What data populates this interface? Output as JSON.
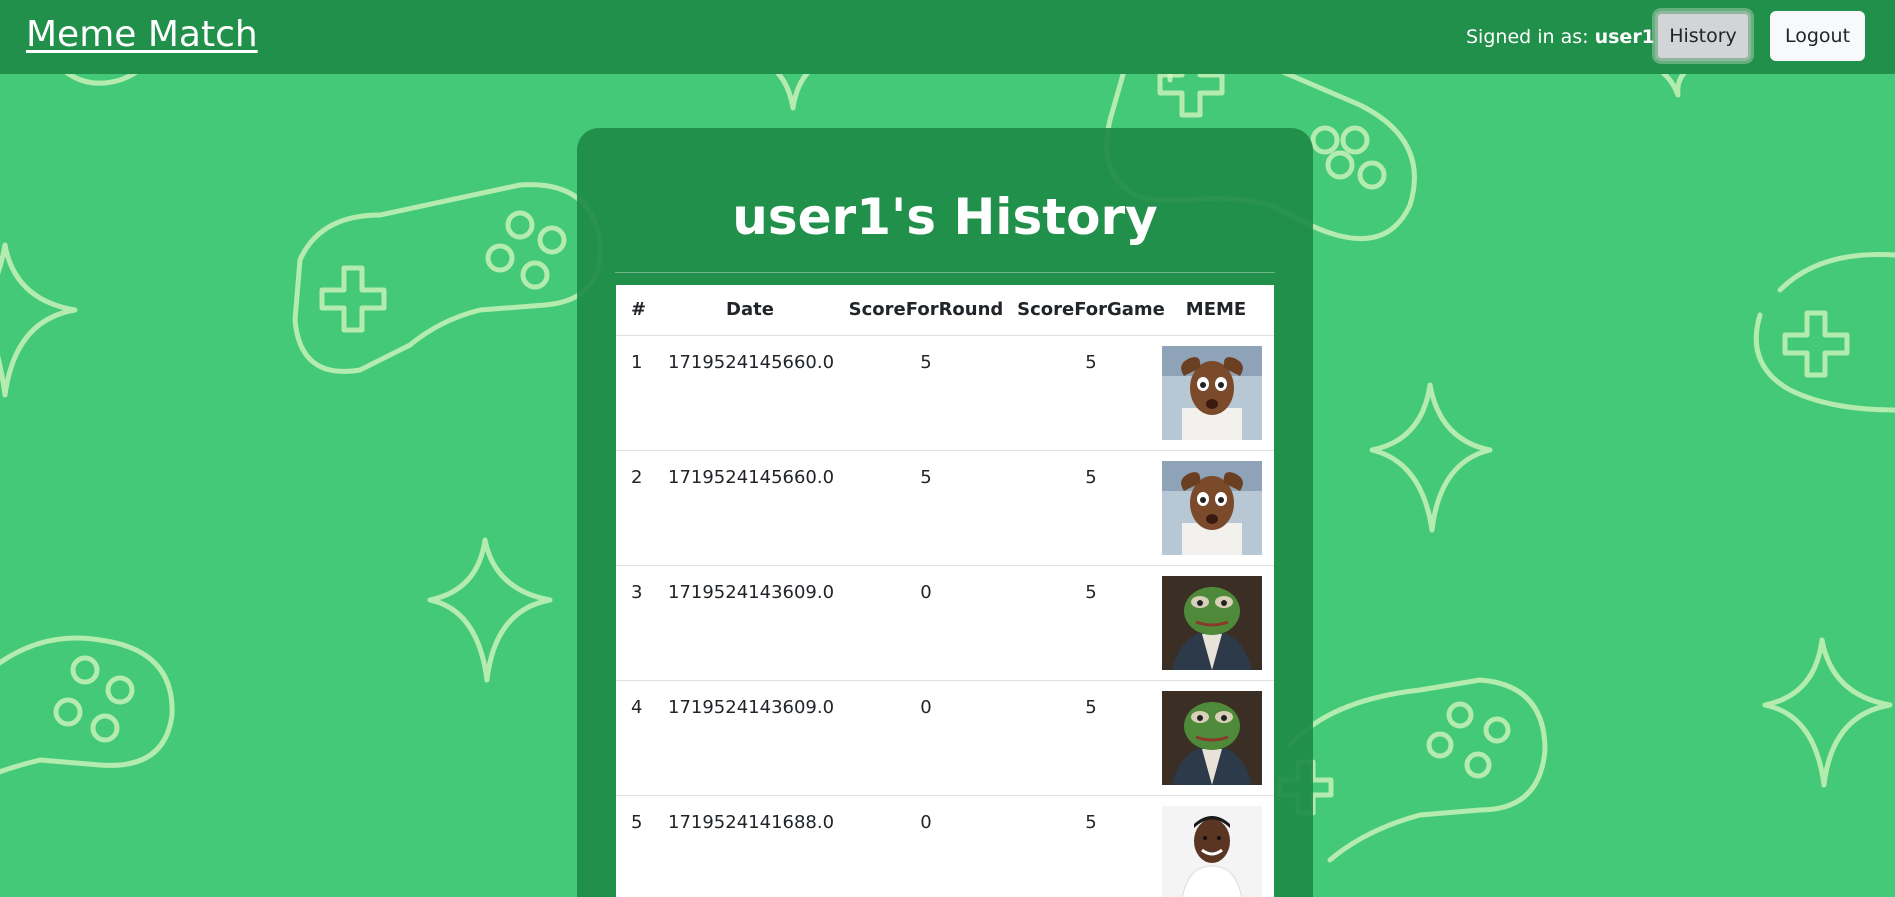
{
  "navbar": {
    "brand": "Meme Match",
    "signed_in_prefix": "Signed in as:",
    "username": "user1",
    "history_button": "History",
    "logout_button": "Logout"
  },
  "page": {
    "title": "user1's History"
  },
  "table": {
    "headers": [
      "#",
      "Date",
      "ScoreForRound",
      "ScoreForGame",
      "MEME"
    ],
    "rows": [
      {
        "num": "1",
        "date": "1719524145660.0",
        "round": "5",
        "game": "5",
        "meme": "shocked-man-meme"
      },
      {
        "num": "2",
        "date": "1719524145660.0",
        "round": "5",
        "game": "5",
        "meme": "shocked-man-meme"
      },
      {
        "num": "3",
        "date": "1719524143609.0",
        "round": "0",
        "game": "5",
        "meme": "pepe-frog-meme"
      },
      {
        "num": "4",
        "date": "1719524143609.0",
        "round": "0",
        "game": "5",
        "meme": "pepe-frog-meme"
      },
      {
        "num": "5",
        "date": "1719524141688.0",
        "round": "0",
        "game": "5",
        "meme": "confused-nick-young-meme"
      }
    ]
  },
  "colors": {
    "background": "#43c977",
    "navbar": "#21904a",
    "panel": "#1e8c48",
    "doodle": "#d9f5c0"
  }
}
